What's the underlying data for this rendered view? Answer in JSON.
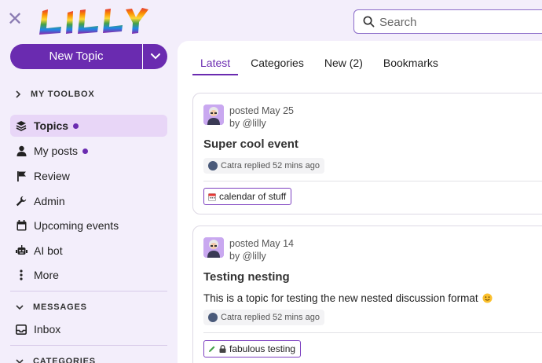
{
  "header": {
    "logo_text": "LILLY",
    "search": {
      "placeholder": "Search"
    }
  },
  "sidebar": {
    "new_topic_label": "New Topic",
    "toolbox_label": "MY TOOLBOX",
    "items": [
      {
        "label": "Topics",
        "icon": "layers-icon",
        "active": true,
        "dot": true
      },
      {
        "label": "My posts",
        "icon": "user-icon",
        "active": false,
        "dot": true
      },
      {
        "label": "Review",
        "icon": "flag-icon",
        "active": false,
        "dot": false
      },
      {
        "label": "Admin",
        "icon": "wrench-icon",
        "active": false,
        "dot": false
      },
      {
        "label": "Upcoming events",
        "icon": "calendar-icon",
        "active": false,
        "dot": false
      },
      {
        "label": "AI bot",
        "icon": "robot-icon",
        "active": false,
        "dot": false
      },
      {
        "label": "More",
        "icon": "ellipsis-vertical-icon",
        "active": false,
        "dot": false
      }
    ],
    "messages_label": "MESSAGES",
    "inbox_label": "Inbox",
    "categories_label": "CATEGORIES"
  },
  "main": {
    "tabs": [
      {
        "label": "Latest",
        "active": true
      },
      {
        "label": "Categories",
        "active": false
      },
      {
        "label": "New (2)",
        "active": false
      },
      {
        "label": "Bookmarks",
        "active": false
      }
    ],
    "topics": [
      {
        "posted": "posted May 25",
        "by": "by @lilly",
        "title": "Super cool event",
        "excerpt": "",
        "reply": "Catra replied 52 mins ago",
        "tag": "calendar of stuff",
        "tag_icon": "calendar-emoji-icon"
      },
      {
        "posted": "posted May 14",
        "by": "by @lilly",
        "title": "Testing nesting",
        "excerpt": "This is a topic for testing the new nested discussion format",
        "reply": "Catra replied 52 mins ago",
        "tag": "fabulous testing",
        "tag_icon": "lock-icon"
      }
    ]
  },
  "colors": {
    "accent": "#6a2bb0",
    "sidebar_bg": "#f3eefb",
    "active_item_bg": "#e8d6f7"
  }
}
